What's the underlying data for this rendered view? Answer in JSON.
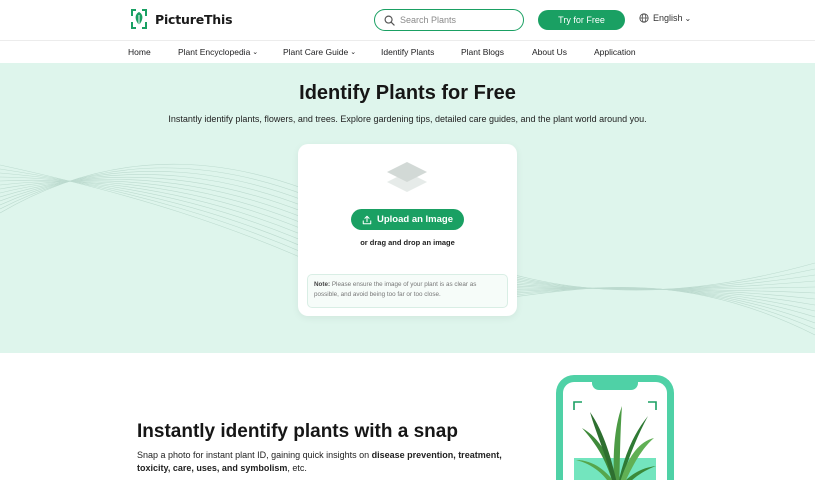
{
  "header": {
    "brand_name": "PictureThis",
    "search_placeholder": "Search Plants",
    "try_button_label": "Try for Free",
    "language_label": "English"
  },
  "nav": {
    "items": [
      {
        "label": "Home",
        "has_dropdown": false
      },
      {
        "label": "Plant Encyclopedia",
        "has_dropdown": true
      },
      {
        "label": "Plant Care Guide",
        "has_dropdown": true
      },
      {
        "label": "Identify Plants",
        "has_dropdown": false
      },
      {
        "label": "Plant Blogs",
        "has_dropdown": false
      },
      {
        "label": "About Us",
        "has_dropdown": false
      },
      {
        "label": "Application",
        "has_dropdown": false
      }
    ]
  },
  "hero": {
    "title": "Identify Plants for Free",
    "subtitle": "Instantly identify plants, flowers, and trees. Explore gardening tips, detailed care guides, and the plant world around you.",
    "upload_button_label": "Upload an Image",
    "drag_text": "or drag and drop an image",
    "note_label": "Note:",
    "note_text": "Please ensure the image of your plant is as clear as possible, and avoid being too far or too close."
  },
  "feature": {
    "title": "Instantly identify plants with a snap",
    "text_start": "Snap a photo for instant plant ID, gaining quick insights on ",
    "text_bold": "disease prevention, treatment, toxicity, care, uses, and symbolism",
    "text_end": ", etc."
  },
  "icons": {
    "logo": "leaf-logo-icon",
    "search": "search-icon",
    "language": "globe-icon",
    "upload": "upload-icon",
    "layers": "layers-icon",
    "chevron": "chevron-down-icon"
  },
  "colors": {
    "brand_green": "#1aa063",
    "hero_background": "#def5ec",
    "phone_frame": "#4fd1a6"
  }
}
